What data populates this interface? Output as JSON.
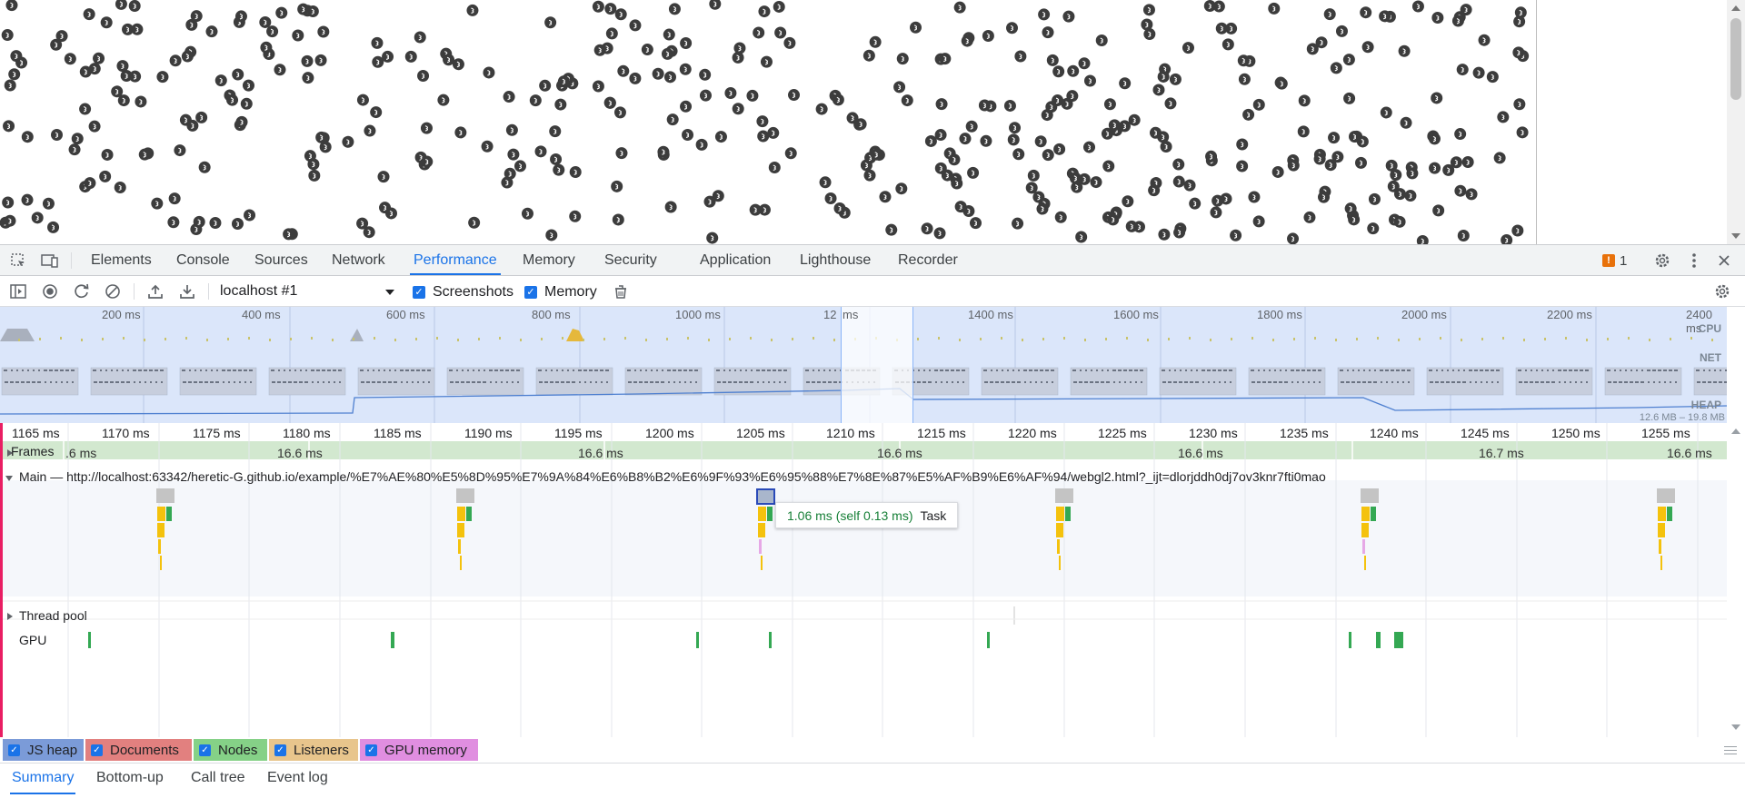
{
  "devtools_tabs": [
    "Elements",
    "Console",
    "Sources",
    "Network",
    "Performance",
    "Memory",
    "Security",
    "Application",
    "Lighthouse",
    "Recorder"
  ],
  "active_tab": "Performance",
  "issues_count": "1",
  "issues_mark": "!",
  "toolbar": {
    "profile": "localhost #1",
    "screenshots_label": "Screenshots",
    "memory_label": "Memory",
    "screenshots_checked": true,
    "memory_checked": true
  },
  "overview": {
    "ruler": [
      "200 ms",
      "400 ms",
      "600 ms",
      "800 ms",
      "1000 ms",
      "12",
      "ms",
      "1400 ms",
      "1600 ms",
      "1800 ms",
      "2000 ms",
      "2200 ms",
      "2400 ms"
    ],
    "cpu_label": "CPU",
    "net_label": "NET",
    "heap_label": "HEAP",
    "heap_range": "12.6 MB – 19.8 MB"
  },
  "flame": {
    "ruler": [
      "1165 ms",
      "1170 ms",
      "1175 ms",
      "1180 ms",
      "1185 ms",
      "1190 ms",
      "1195 ms",
      "1200 ms",
      "1205 ms",
      "1210 ms",
      "1215 ms",
      "1220 ms",
      "1225 ms",
      "1230 ms",
      "1235 ms",
      "1240 ms",
      "1245 ms",
      "1250 ms",
      "1255 ms"
    ],
    "frames_label": "Frames",
    "frame_durations": [
      ".6 ms",
      "16.6 ms",
      "16.6 ms",
      "16.6 ms",
      "16.6 ms",
      "16.7 ms",
      "16.6 ms"
    ],
    "main_label": "Main — http://localhost:63342/heretic-G.github.io/example/%E7%AE%80%E5%8D%95%E7%9A%84%E6%B8%B2%E6%9F%93%E6%95%88%E7%8E%87%E5%AF%B9%E6%AF%94/webgl2.html?_ijt=dlorjddh0dj7ov3knr7fti0mao",
    "thread_pool_label": "Thread pool",
    "gpu_label": "GPU",
    "tooltip": {
      "duration": "1.06 ms (self 0.13 ms)",
      "name": "Task"
    }
  },
  "counters": [
    "JS heap",
    "Documents",
    "Nodes",
    "Listeners",
    "GPU memory"
  ],
  "counter_colors": [
    "#7b9bd8",
    "#e2807f",
    "#85d187",
    "#e8c58c",
    "#e08ee0"
  ],
  "bottom_tabs": [
    "Summary",
    "Bottom-up",
    "Call tree",
    "Event log"
  ],
  "active_bottom_tab": "Summary"
}
